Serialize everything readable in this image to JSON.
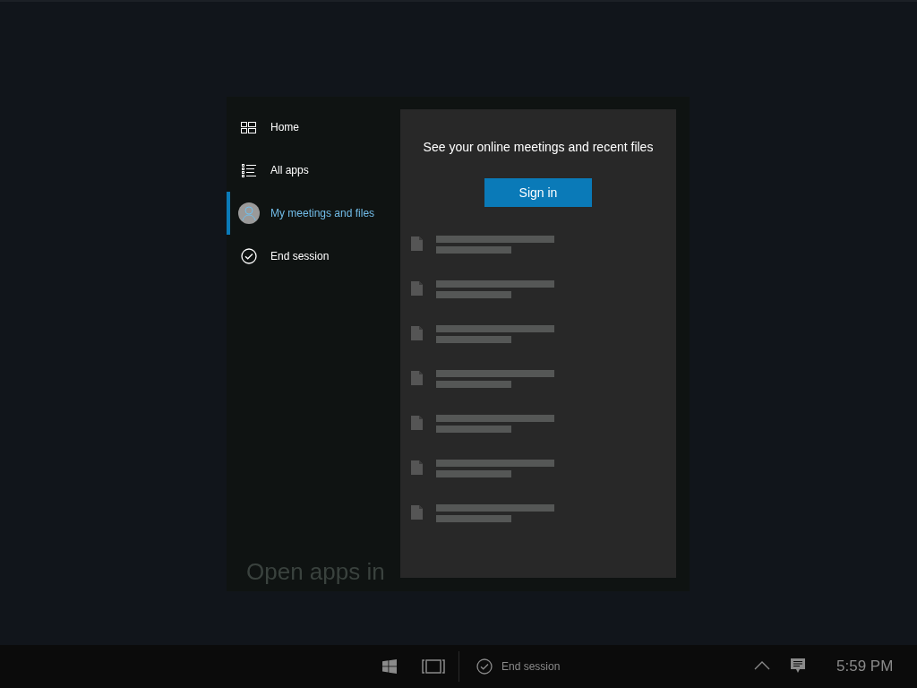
{
  "background_hint": "Open apps in",
  "nav": [
    {
      "kind": "home",
      "label": "Home",
      "selected": false
    },
    {
      "kind": "apps",
      "label": "All apps",
      "selected": false
    },
    {
      "kind": "person",
      "label": "My meetings and files",
      "selected": true
    },
    {
      "kind": "check",
      "label": "End session",
      "selected": false
    }
  ],
  "panel": {
    "message": "See your online meetings and recent files",
    "button": "Sign in"
  },
  "taskbar": {
    "end_session": "End session",
    "time": "5:59 PM"
  }
}
